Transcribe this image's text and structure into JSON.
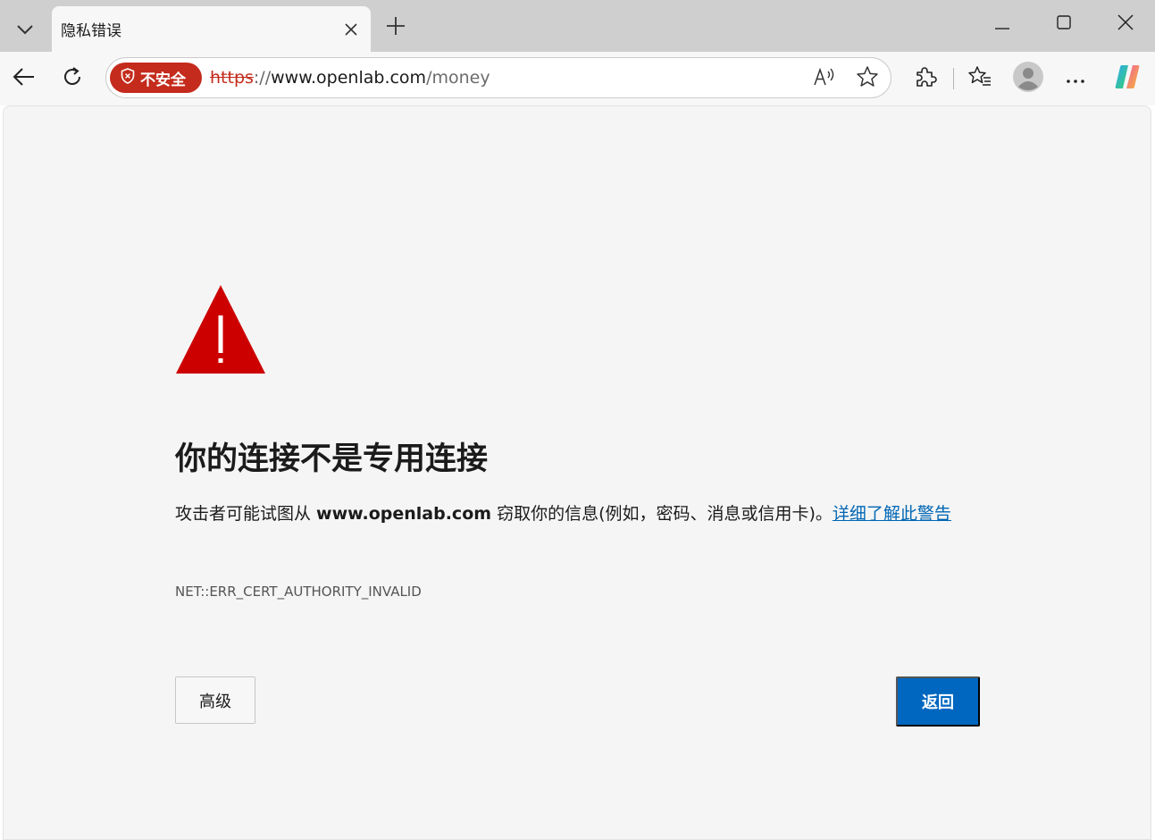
{
  "tab": {
    "title": "隐私错误"
  },
  "toolbar": {
    "security_label": "不安全",
    "url": {
      "scheme": "https",
      "separator": "://",
      "host": "www.openlab.com",
      "path": "/money"
    }
  },
  "error": {
    "title": "你的连接不是专用连接",
    "description_prefix": "攻击者可能试图从 ",
    "description_host": "www.openlab.com",
    "description_suffix": " 窃取你的信息(例如，密码、消息或信用卡)。",
    "learn_more_link": "详细了解此警告",
    "code": "NET::ERR_CERT_AUTHORITY_INVALID",
    "advanced_button": "高级",
    "back_button": "返回"
  },
  "colors": {
    "warning_red": "#c42b1c",
    "primary_blue": "#0067c0",
    "link_blue": "#0066b4"
  },
  "icons": [
    "chevron-down-icon",
    "close-icon",
    "plus-icon",
    "minimize-icon",
    "maximize-icon",
    "back-arrow-icon",
    "refresh-icon",
    "shield-icon",
    "read-aloud-icon",
    "favorite-star-icon",
    "extensions-icon",
    "favorites-list-icon",
    "profile-avatar-icon",
    "more-icon",
    "copilot-icon",
    "warning-triangle-icon"
  ]
}
